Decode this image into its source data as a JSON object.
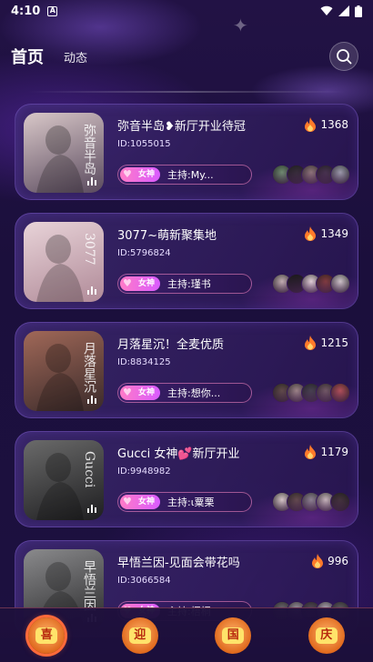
{
  "status_bar": {
    "time": "4:10",
    "notification_glyph": "A"
  },
  "header": {
    "tab_home": "首页",
    "tab_dynamic": "动态"
  },
  "rooms": [
    {
      "title": "弥音半岛❥新厅开业待冠",
      "id": "ID:1055015",
      "heat": "1368",
      "badge": "女神",
      "host": "主持:My...",
      "cover_text": "弥音半岛",
      "cover_colors": [
        "#5a4a5e",
        "#d8c7c8"
      ],
      "avatar_colors": [
        "#6b8f6a",
        "#2a2a2a",
        "#8a7a70",
        "#3b3040",
        "#9aa0a8"
      ]
    },
    {
      "title": "3077~萌新聚集地",
      "id": "ID:5796824",
      "heat": "1349",
      "badge": "女神",
      "host": "主持:瑾书",
      "cover_text": "3077",
      "cover_colors": [
        "#b08a98",
        "#e8d3d8"
      ],
      "avatar_colors": [
        "#c4b6b0",
        "#1a1a1a",
        "#e8e0d8",
        "#7a3a30",
        "#d0ccc8"
      ]
    },
    {
      "title": "月落星沉！全麦优质",
      "id": "ID:8834125",
      "heat": "1215",
      "badge": "女神",
      "host": "主持:想你...",
      "cover_text": "月落星沉",
      "cover_colors": [
        "#3a2a2a",
        "#a06858"
      ],
      "avatar_colors": [
        "#5a4a40",
        "#9a8a80",
        "#3a4040",
        "#6a5a5a",
        "#b05050"
      ]
    },
    {
      "title": "Gucci 女神💕新厅开业",
      "id": "ID:9948982",
      "heat": "1179",
      "badge": "女神",
      "host": "主持:ι粟栗",
      "cover_text": "Gucci",
      "cover_colors": [
        "#1e1e20",
        "#6a6a6a"
      ],
      "avatar_colors": [
        "#d8cfc6",
        "#5a4a40",
        "#8a8a8a",
        "#c8c0b8",
        "#3a3030"
      ]
    },
    {
      "title": "早悟兰因-见面会带花吗",
      "id": "ID:3066584",
      "heat": "996",
      "badge": "女神",
      "host": "主持:梧桐",
      "cover_text": "早悟兰因",
      "cover_colors": [
        "#2a2a2c",
        "#8a8a8c"
      ],
      "avatar_colors": [
        "#6a6a6a",
        "#9a9a9a",
        "#4a4a4a",
        "#b0b0b0",
        "#5a5a5a"
      ]
    }
  ],
  "tabbar": {
    "tab1": "喜",
    "tab2": "迎",
    "tab3": "国",
    "tab4": "庆"
  },
  "colors": {
    "background": "#1a0d38",
    "accent": "#8a6cff",
    "badge_pink": "#ff7bc7",
    "flame": "#ff7a2a"
  }
}
